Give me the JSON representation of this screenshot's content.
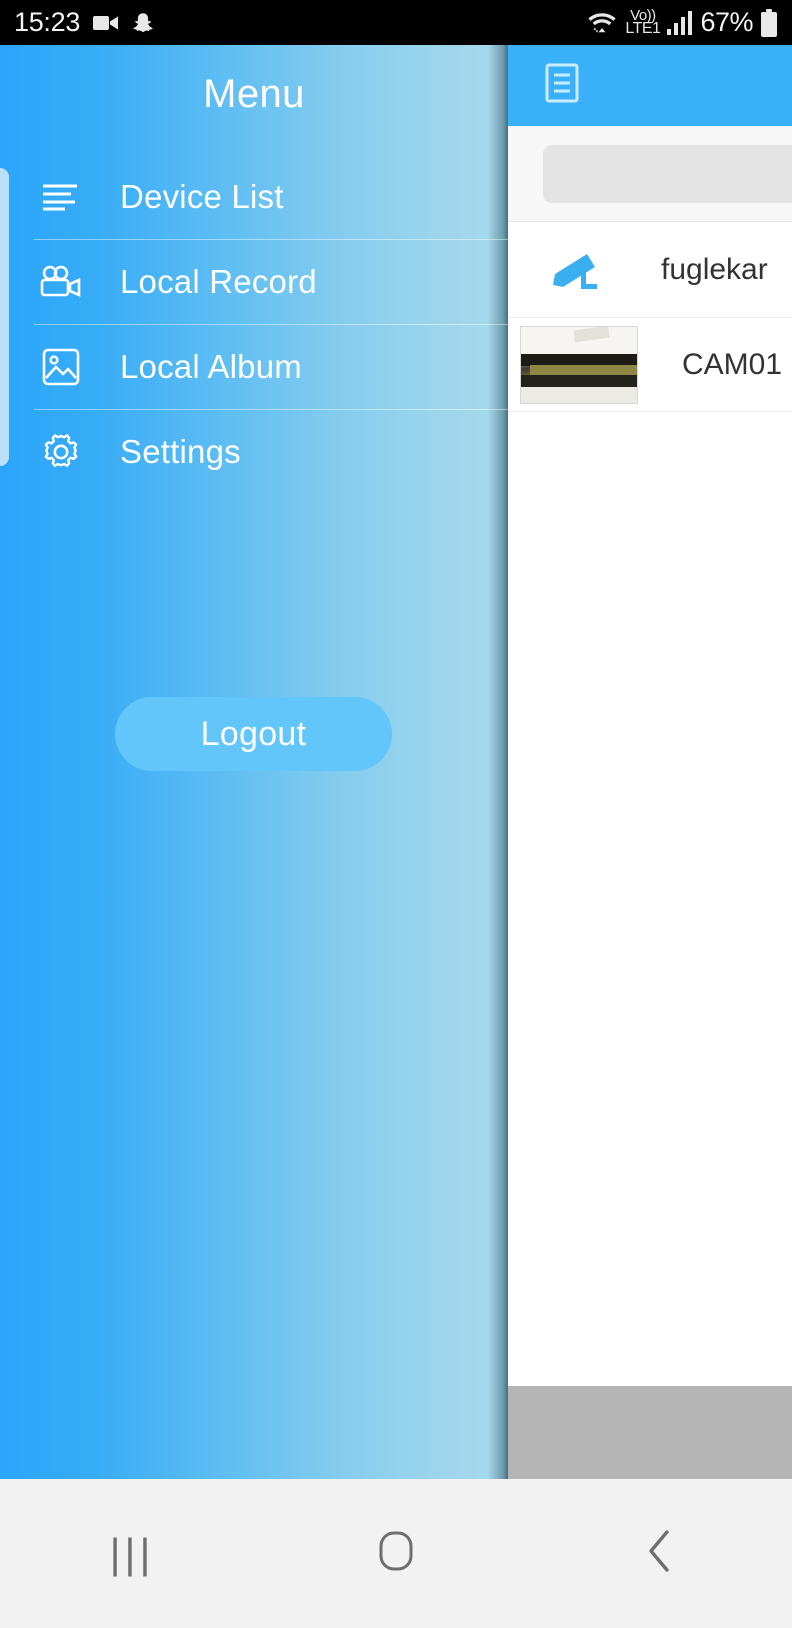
{
  "status_bar": {
    "time": "15:23",
    "left_icons": [
      "video-camera-icon",
      "snapchat-icon"
    ],
    "network_label": "Vo))",
    "network_sub": "LTE1",
    "battery_percent": "67%",
    "right_icons": [
      "wifi-icon",
      "volte-icon",
      "signal-bars-icon",
      "battery-icon"
    ]
  },
  "drawer": {
    "title": "Menu",
    "items": [
      {
        "label": "Device List",
        "icon": "list-lines-icon"
      },
      {
        "label": "Local Record",
        "icon": "video-camera-icon"
      },
      {
        "label": "Local Album",
        "icon": "image-icon"
      },
      {
        "label": "Settings",
        "icon": "gear-icon"
      }
    ],
    "logout_label": "Logout",
    "gradient_from": "#2ba6fa",
    "gradient_to": "#a5d8ec"
  },
  "device_panel": {
    "header_icon": "document-list-icon",
    "header_color": "#3bb0fa",
    "search": {
      "value": "",
      "placeholder": ""
    },
    "rows": [
      {
        "name": "fuglekar",
        "icon": "cctv-camera-icon",
        "thumbnail": false
      },
      {
        "name": "CAM01",
        "icon": "",
        "thumbnail": true
      }
    ],
    "bottom_bar_color": "#b4b4b4"
  },
  "nav_bar": {
    "recents_glyph": "|||",
    "buttons": [
      "recents-button",
      "home-button",
      "back-button"
    ],
    "background": "#f2f2f2",
    "icon_color": "#6e6e6e"
  }
}
